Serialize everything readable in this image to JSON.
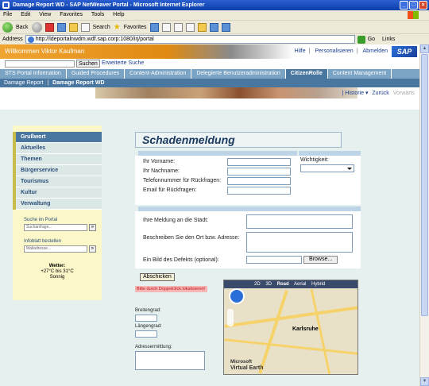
{
  "window": {
    "title": "Damage Report WD - SAP NetWeaver Portal - Microsoft Internet Explorer"
  },
  "menu": [
    "File",
    "Edit",
    "View",
    "Favorites",
    "Tools",
    "Help"
  ],
  "toolbar": {
    "back": "Back",
    "search": "Search",
    "favorites": "Favorites"
  },
  "address": {
    "label": "Address",
    "url": "http://ldeportalnwdm.wdf.sap.corp:1080/irj/portal",
    "go": "Go",
    "links": "Links"
  },
  "portal": {
    "welcome": "Willkommen Viktor Kaufman",
    "help": "Hilfe",
    "personalize": "Personalisieren",
    "logoff": "Abmelden",
    "logo": "SAP",
    "search_btn": "Suchen",
    "advanced": "Erweiterte Suche"
  },
  "tabs": [
    "STS Portal Information",
    "Guided Procedures",
    "Content-Administration",
    "Delegierte Benutzeradministration",
    "CitizenRolle",
    "Content Management"
  ],
  "active_tab": "CitizenRolle",
  "subtabs": {
    "first": "Damage Report",
    "second": "Damage Report WD"
  },
  "history": {
    "label": "Historie",
    "back": "Zurück",
    "forward": "Vorwärts"
  },
  "sidebar": {
    "items": [
      "Grußwort",
      "Aktuelles",
      "Themen",
      "Bürgerservice",
      "Tourismus",
      "Kultur",
      "Verwaltung"
    ],
    "search_label": "Suche im Portal",
    "search_placeholder": "Suchanfrage...",
    "info_label": "Infoblatt bestellen",
    "info_placeholder": "Mailadresse...",
    "weather_title": "Wetter:",
    "weather_temp": "+27°C bis 31°C",
    "weather_desc": "Sonnig"
  },
  "form": {
    "title": "Schadenmeldung",
    "vorname": "Ihr Vorname:",
    "nachname": "Ihr Nachname:",
    "telefon": "Telefonnummer für Rückfragen:",
    "email": "Email für Rückfragen:",
    "wichtigkeit": "Wichtigkeit:",
    "meldung": "Ihre Meldung an die Stadt:",
    "ort": "Beschreiben Sie den Ort bzw. Adresse:",
    "bild": "Ein Bild des Defekts (optional):",
    "browse": "Browse...",
    "submit": "Abschicken",
    "locate_msg": "Bitte durch Doppelclick lokalisieren!",
    "breitengrad": "Breitengrad:",
    "laengengrad": "Längengrad:",
    "adresse": "Adressermittlung:"
  },
  "map": {
    "modes": [
      "2D",
      "3D",
      "Road",
      "Aerial",
      "Hybrid"
    ],
    "city": "Karlsruhe",
    "brand_top": "Microsoft",
    "brand_bottom": "Virtual Earth"
  }
}
